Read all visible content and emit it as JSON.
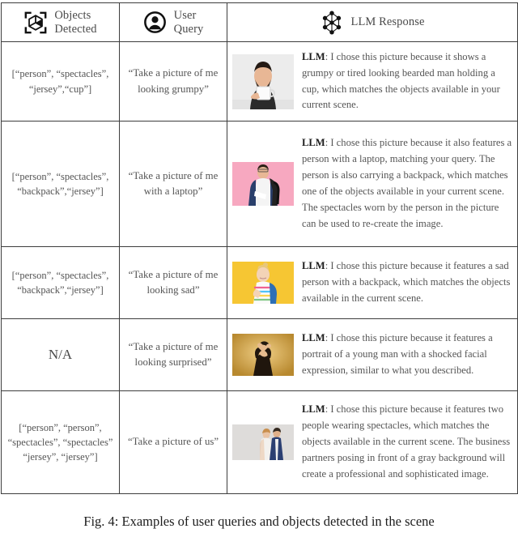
{
  "figure": {
    "caption": "Fig. 4: Examples of user queries and objects detected in the scene"
  },
  "table": {
    "headers": [
      {
        "label_line1": "Objects",
        "label_line2": "Detected",
        "icon": "cube-scan-icon"
      },
      {
        "label_line1": "User",
        "label_line2": "Query",
        "icon": "user-avatar-icon"
      },
      {
        "label_line1": "LLM Response",
        "label_line2": "",
        "icon": "neural-network-icon"
      }
    ],
    "rows": [
      {
        "objects": "[“person”,  “spectacles”, “jersey”,“cup”]",
        "query": "“Take a picture of me looking grumpy”",
        "response_prefix": "LLM",
        "response": ": I chose this picture because it shows a grumpy or tired looking bearded man holding a cup, which matches the objects available in your current scene.",
        "image_alt": "grumpy-bearded-man-holding-cup",
        "image_bg": "#ededed"
      },
      {
        "objects": "[“person”,  “spectacles”, “backpack”,“jersey”]",
        "query": "“Take a picture of me with a laptop”",
        "response_prefix": "LLM",
        "response": ": I chose this picture because it also features a person with a laptop, matching your query. The person is also carrying a backpack, which matches one of the objects available in your current scene. The spectacles worn by the person in the picture can be used to re-create the image.",
        "image_alt": "student-with-laptop-and-backpack",
        "image_bg": "#f7a8c0"
      },
      {
        "objects": "[“person”,  “spectacles”, “backpack”,“jersey”]",
        "query": "“Take a picture of me looking sad”",
        "response_prefix": "LLM",
        "response": ": I chose this picture because it features a sad person with a backpack, which matches the objects available in the current scene.",
        "image_alt": "sad-child-with-backpack",
        "image_bg": "#f6c633"
      },
      {
        "objects": "N/A",
        "query": "“Take a picture of me looking surprised”",
        "response_prefix": "LLM",
        "response": ": I chose this picture because it features a portrait of a young man with a shocked facial expression, similar to what you described.",
        "image_alt": "shocked-young-man-portrait",
        "image_bg": "#c4932f"
      },
      {
        "objects": "[“person”,  “person”, “spectacles”, “spectacles” “jersey”, “jersey”]",
        "query": "“Take a picture of us”",
        "response_prefix": "LLM",
        "response": ": I chose this picture because it features two people wearing spectacles, which matches the objects available in the current scene. The business partners posing in front of a gray background will create a professional and sophisticated image.",
        "image_alt": "two-business-partners-gray-background",
        "image_bg": "#dcdcdc"
      }
    ]
  },
  "colors": {
    "border": "#3d3d3d",
    "text": "#555555",
    "heading": "#4a4a4a"
  }
}
